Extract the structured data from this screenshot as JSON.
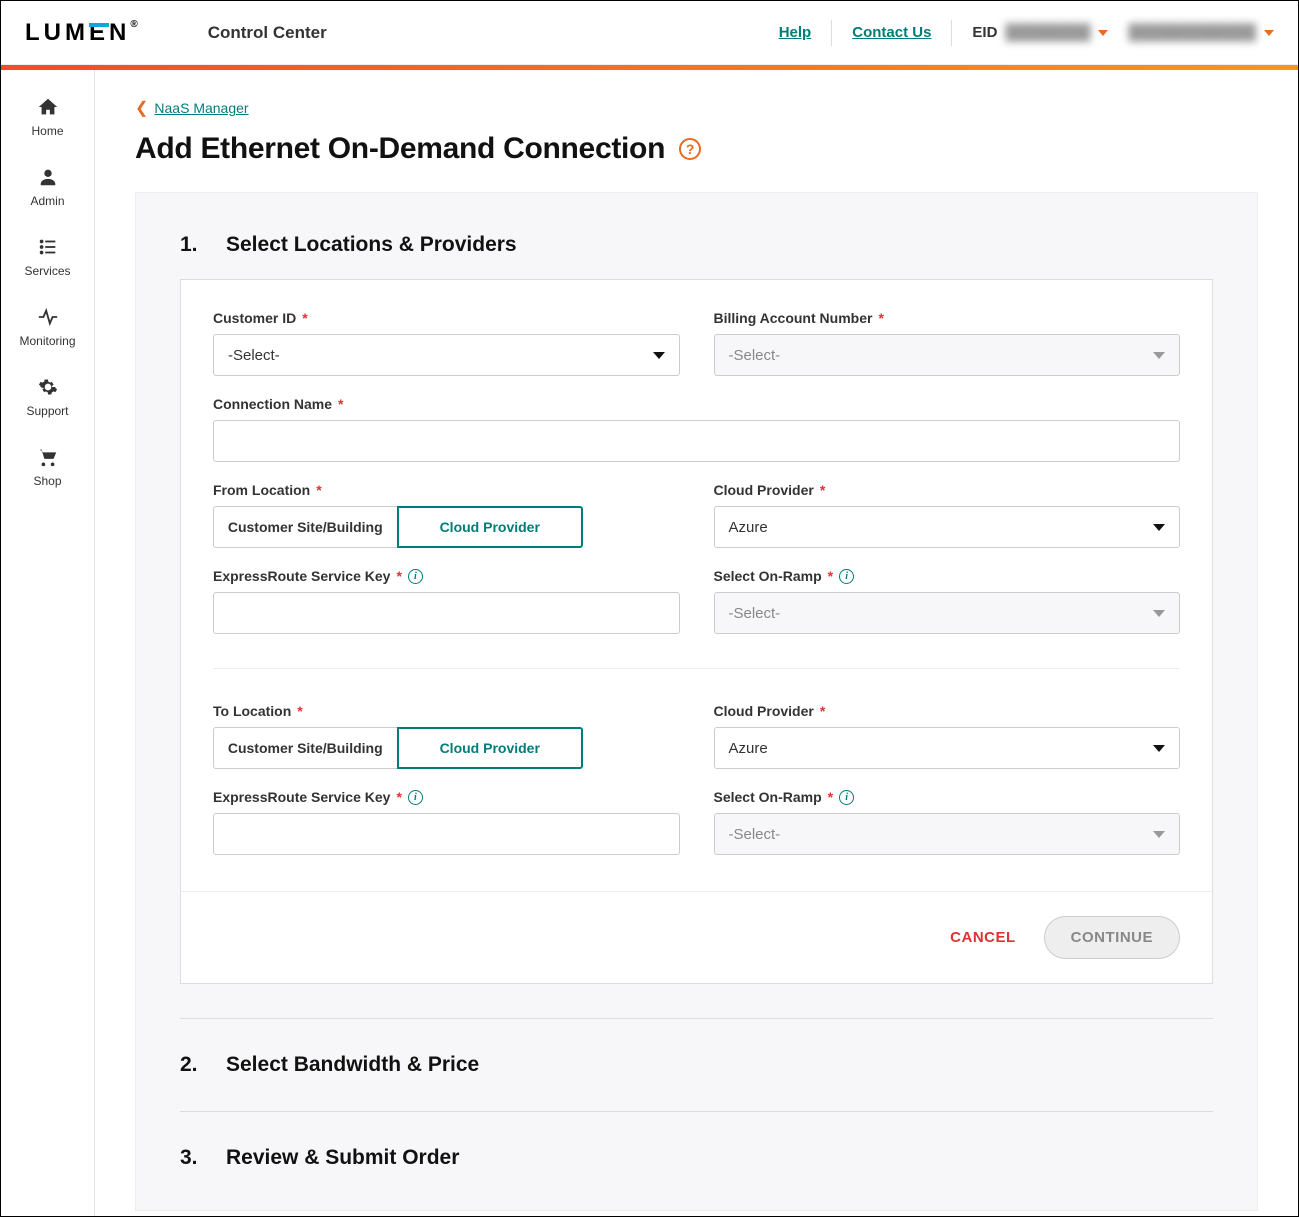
{
  "header": {
    "logo_text": "LUMEN",
    "app_title": "Control Center",
    "help_label": "Help",
    "contact_label": "Contact Us",
    "eid_label": "EID",
    "eid_value": "████████",
    "account_name": "████████████"
  },
  "sidebar": {
    "items": [
      {
        "label": "Home"
      },
      {
        "label": "Admin"
      },
      {
        "label": "Services"
      },
      {
        "label": "Monitoring"
      },
      {
        "label": "Support"
      },
      {
        "label": "Shop"
      }
    ]
  },
  "breadcrumb": {
    "back_label": "NaaS Manager"
  },
  "page": {
    "title": "Add Ethernet On-Demand Connection"
  },
  "step1": {
    "number": "1.",
    "title": "Select Locations & Providers",
    "customer_id_label": "Customer ID",
    "customer_id_value": "-Select-",
    "billing_label": "Billing Account Number",
    "billing_value": "-Select-",
    "connection_name_label": "Connection Name",
    "connection_name_value": "",
    "from_location_label": "From Location",
    "to_location_label": "To Location",
    "toggle_option_site": "Customer Site/Building",
    "toggle_option_cloud": "Cloud Provider",
    "cloud_provider_label": "Cloud Provider",
    "cloud_provider_value": "Azure",
    "expressroute_label": "ExpressRoute Service Key",
    "expressroute_value": "",
    "onramp_label": "Select On-Ramp",
    "onramp_value": "-Select-",
    "cancel_label": "CANCEL",
    "continue_label": "CONTINUE"
  },
  "step2": {
    "number": "2.",
    "title": "Select Bandwidth & Price"
  },
  "step3": {
    "number": "3.",
    "title": "Review & Submit Order"
  }
}
